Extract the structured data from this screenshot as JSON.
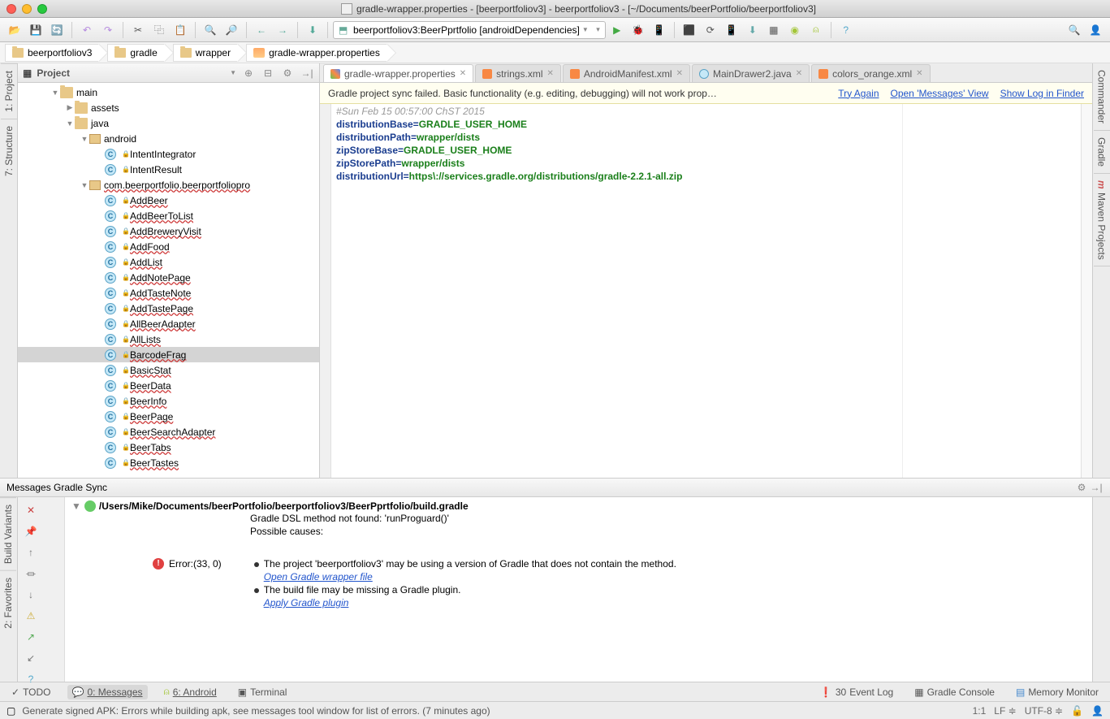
{
  "window": {
    "title": "gradle-wrapper.properties - [beerportfoliov3] - beerportfoliov3 - [~/Documents/beerPortfolio/beerportfoliov3]"
  },
  "toolbar": {
    "run_config": "beerportfoliov3:BeerPprtfolio [androidDependencies]"
  },
  "breadcrumbs": [
    "beerportfoliov3",
    "gradle",
    "wrapper",
    "gradle-wrapper.properties"
  ],
  "project_panel": {
    "title": "Project"
  },
  "tree": {
    "main": "main",
    "assets": "assets",
    "java": "java",
    "android": "android",
    "intent_integrator": "IntentIntegrator",
    "intent_result": "IntentResult",
    "package": "com.beerportfolio.beerportfoliopro",
    "classes": [
      "AddBeer",
      "AddBeerToList",
      "AddBreweryVisit",
      "AddFood",
      "AddList",
      "AddNotePage",
      "AddTasteNote",
      "AddTastePage",
      "AllBeerAdapter",
      "AllLists",
      "BarcodeFrag",
      "BasicStat",
      "BeerData",
      "BeerInfo",
      "BeerPage",
      "BeerSearchAdapter",
      "BeerTabs",
      "BeerTastes"
    ]
  },
  "editor_tabs": [
    {
      "label": "gradle-wrapper.properties",
      "type": "props",
      "active": true
    },
    {
      "label": "strings.xml",
      "type": "xml"
    },
    {
      "label": "AndroidManifest.xml",
      "type": "xml"
    },
    {
      "label": "MainDrawer2.java",
      "type": "java"
    },
    {
      "label": "colors_orange.xml",
      "type": "xml"
    }
  ],
  "notification": {
    "text": "Gradle project sync failed. Basic functionality (e.g. editing, debugging) will not work prop…",
    "link1": "Try Again",
    "link2": "Open 'Messages' View",
    "link3": "Show Log in Finder"
  },
  "code": {
    "comment": "#Sun Feb 15 00:57:00 ChST 2015",
    "l1k": "distributionBase=",
    "l1v": "GRADLE_USER_HOME",
    "l2k": "distributionPath=",
    "l2v": "wrapper/dists",
    "l3k": "zipStoreBase=",
    "l3v": "GRADLE_USER_HOME",
    "l4k": "zipStorePath=",
    "l4v": "wrapper/dists",
    "l5k": "distributionUrl=",
    "l5v": "https\\://services.gradle.org/distributions/gradle-2.2.1-all.zip"
  },
  "messages": {
    "header": "Messages Gradle Sync",
    "path": "/Users/Mike/Documents/beerPortfolio/beerportfoliov3/BeerPprtfolio/build.gradle",
    "line1": "Gradle DSL method not found: 'runProguard()'",
    "line2": "Possible causes:",
    "error_label": "Error:(33, 0)",
    "cause1": "The project 'beerportfoliov3' may be using a version of Gradle that does not contain the method.",
    "link1": "Open Gradle wrapper file",
    "cause2": "The build file may be missing a Gradle plugin.",
    "link2": "Apply Gradle plugin"
  },
  "left_rail": {
    "project": "1: Project",
    "structure": "7: Structure"
  },
  "right_rail": {
    "commander": "Commander",
    "gradle": "Gradle",
    "maven": "Maven Projects"
  },
  "bottom_rail": {
    "build": "Build Variants",
    "favorites": "2: Favorites"
  },
  "bottom_bar": {
    "todo": "TODO",
    "messages": "0: Messages",
    "android": "6: Android",
    "terminal": "Terminal",
    "event_log_count": "30",
    "event_log": "Event Log",
    "gradle_console": "Gradle Console",
    "memory": "Memory Monitor"
  },
  "status": {
    "text": "Generate signed APK: Errors while building apk, see messages tool window for list of errors. (7 minutes ago)",
    "pos": "1:1",
    "line_sep": "LF",
    "encoding": "UTF-8"
  }
}
